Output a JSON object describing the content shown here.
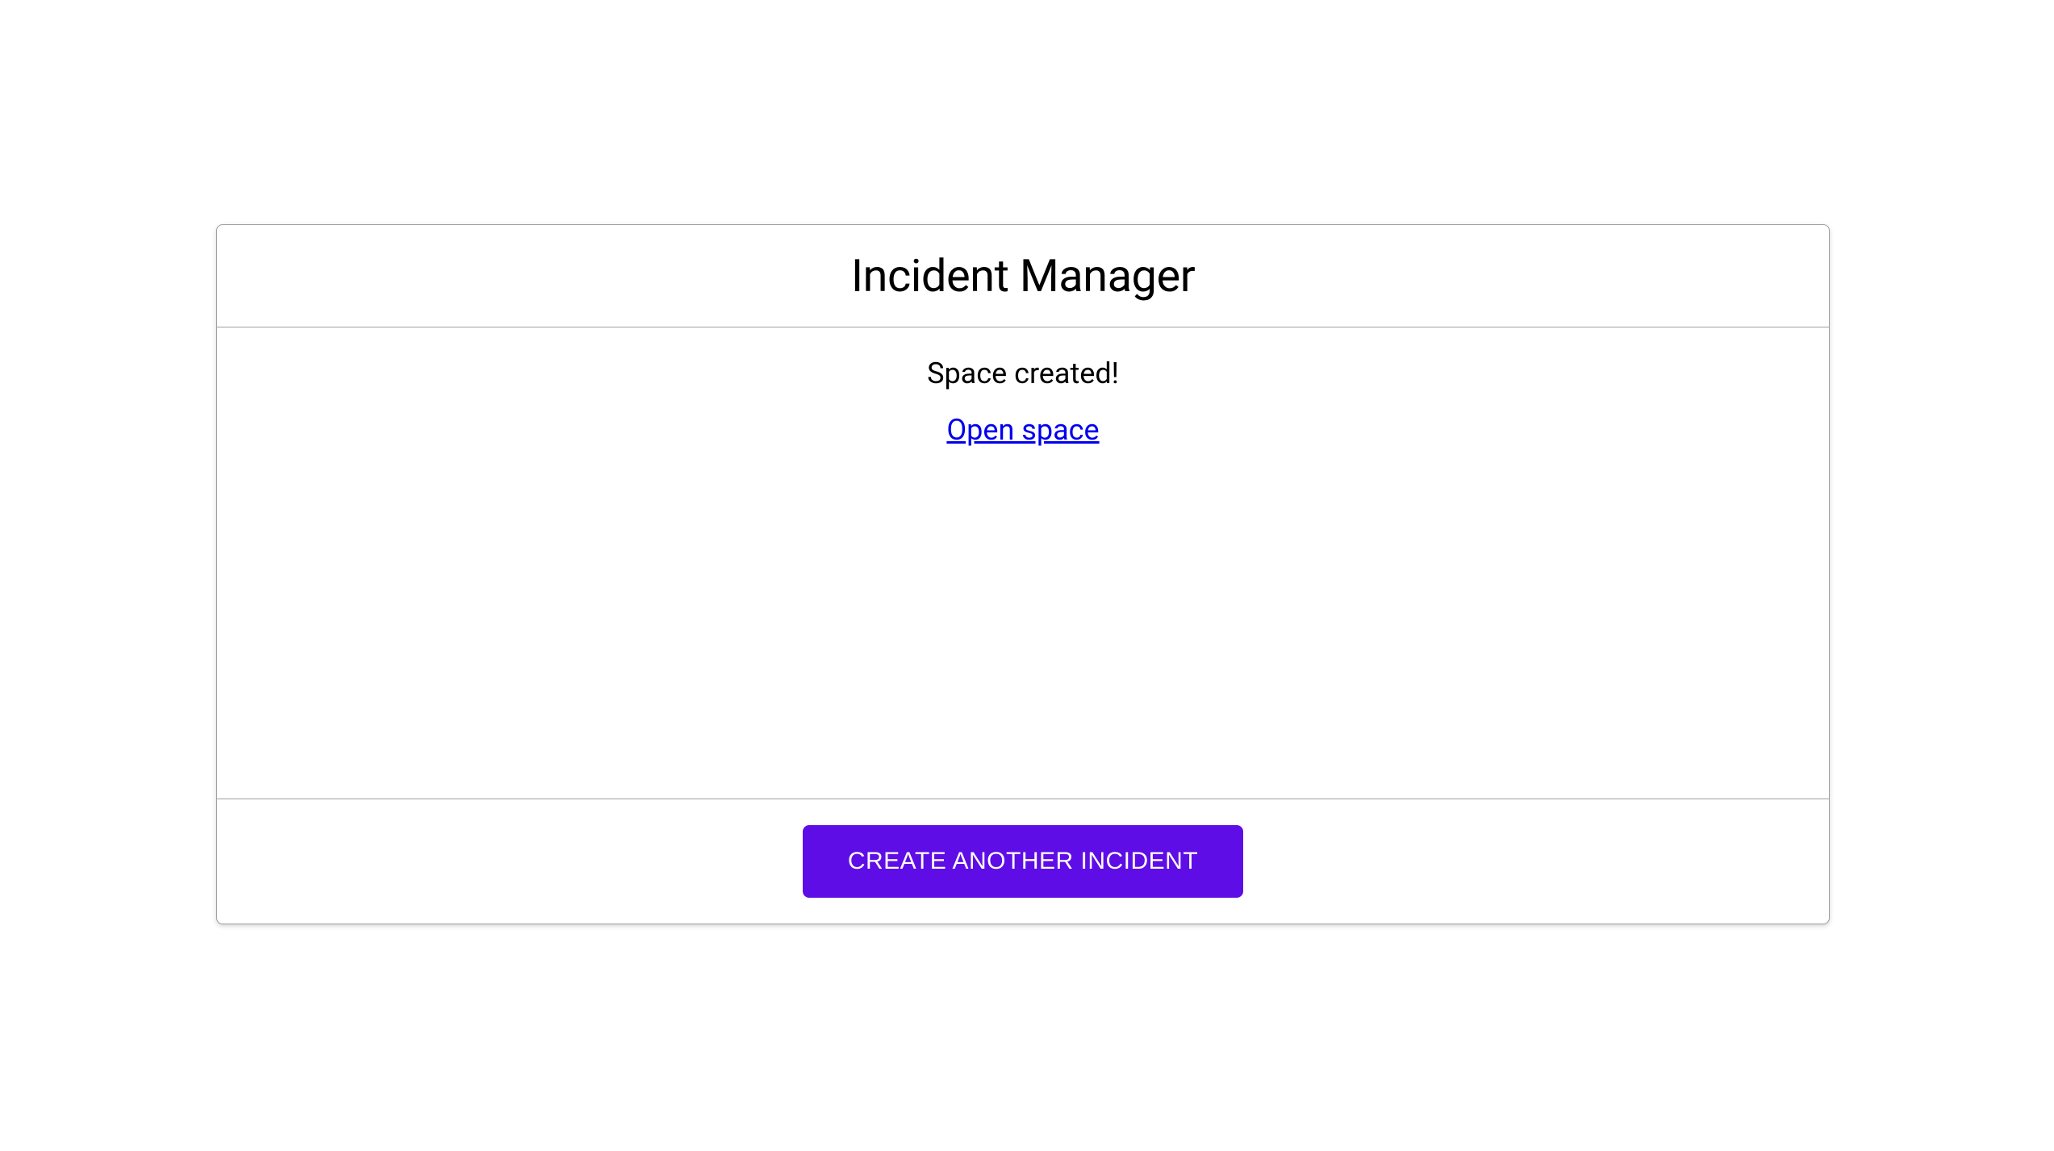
{
  "card": {
    "title": "Incident Manager",
    "status_message": "Space created!",
    "link_label": "Open space",
    "button_label": "CREATE ANOTHER INCIDENT"
  },
  "colors": {
    "primary": "#5e0de6",
    "link": "#0000ee",
    "border": "#9e9e9e"
  }
}
